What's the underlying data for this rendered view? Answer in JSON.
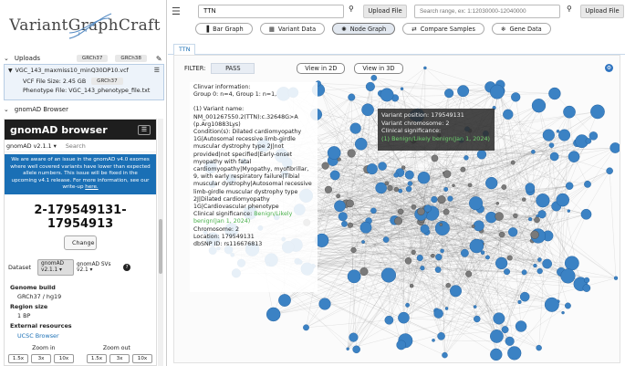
{
  "app": {
    "logo_left": "Variant",
    "logo_right": "GraphCraft"
  },
  "sidebar": {
    "uploads_label": "Uploads",
    "genome_tags": [
      "GRCh37",
      "GRCh38"
    ],
    "file": {
      "name": "VGC_143_maxmiss10_minQ30DP10.vcf",
      "size_text": "VCF File Size: 2.45 GB",
      "genome": "GRCh37",
      "phenotype_text": "Phenotype File: VGC_143_phenotype_file.txt"
    },
    "gnomad_section_label": "gnomAD Browser"
  },
  "gnomad": {
    "title": "gnomAD browser",
    "version": "gnomAD v2.1.1",
    "search_placeholder": "Search",
    "notice_text": "We are aware of an issue in the gnomAD v4.0 exomes where well covered variants have lower than expected allele numbers. This issue will be fixed in the upcoming v4.1 release. For more information, see our write-up",
    "notice_link": "here.",
    "region": "2-179549131-17954913",
    "change_label": "Change",
    "dataset_label": "Dataset",
    "dataset_primary": "gnomAD v2.1.1",
    "dataset_secondary": "gnomAD SVs v2.1",
    "help_icon": "?",
    "genome_build_label": "Genome build",
    "genome_build_value": "GRCh37 / hg19",
    "region_size_label": "Region size",
    "region_size_value": "1 BP",
    "external_label": "External resources",
    "ucsc_link": "UCSC Browser",
    "zoom_in_label": "Zoom in",
    "zoom_out_label": "Zoom out",
    "zoom_in_buttons": [
      "1.5x",
      "3x",
      "10x"
    ],
    "zoom_out_buttons": [
      "1.5x",
      "3x",
      "10x"
    ]
  },
  "toolbar": {
    "gene_value": "TTN",
    "upload_label": "Upload File",
    "range_placeholder": "Search range, ex: 1:12030000-12040000",
    "upload2_label": "Upload File"
  },
  "view_tabs": [
    {
      "label": "Bar Graph",
      "icon": "bar-chart-icon",
      "glyph": "▐",
      "active": false
    },
    {
      "label": "Variant Data",
      "icon": "table-icon",
      "glyph": "▦",
      "active": false
    },
    {
      "label": "Node Graph",
      "icon": "node-graph-icon",
      "glyph": "✺",
      "active": true
    },
    {
      "label": "Compare Samples",
      "icon": "compare-icon",
      "glyph": "⇄",
      "active": false
    },
    {
      "label": "Gene Data",
      "icon": "dna-icon",
      "glyph": "❄",
      "active": false
    }
  ],
  "content_tab": "TTN",
  "graph": {
    "filter_label": "FILTER:",
    "filter_value": "PASS",
    "view2d_label": "View in 2D",
    "view3d_label": "View in 3D",
    "accent_color": "#3b82c4",
    "info": {
      "header": "Clinvar information:",
      "groups": "Group 0: n=4, Group 1: n=1,",
      "variant_name_intro": "(1) Variant name:",
      "variant_name": "NM_001267550.2(TTN):c.32648G>A (p.Arg10883Lys)",
      "conditions": "Condition(s): Dilated cardiomyopathy 1G|Autosomal recessive limb-girdle muscular dystrophy type 2J|not provided|not specified|Early-onset myopathy with fatal cardiomyopathy|Myopathy, myofibrillar, 9, with early respiratory failure|Tibial muscular dystrophy|Autosomal recessive limb-girdle muscular dystrophy type 2J|Dilated cardiomyopathy 1G|Cardiovascular phenotype",
      "significance_label": "Clinical significance:",
      "significance_value": "Benign/Likely benign(Jan 1, 2024)",
      "chromosome": "Chromosome: 2",
      "location": "Location: 179549131",
      "dbsnp": "dbSNP ID: rs116676813"
    },
    "tooltip": {
      "position": "Variant position: 179549131",
      "chromosome": "Variant chromosome: 2",
      "significance_label": "Clinical significance:",
      "significance_value": "(1) Benign/Likely benign(Jan 1, 2024)"
    }
  }
}
